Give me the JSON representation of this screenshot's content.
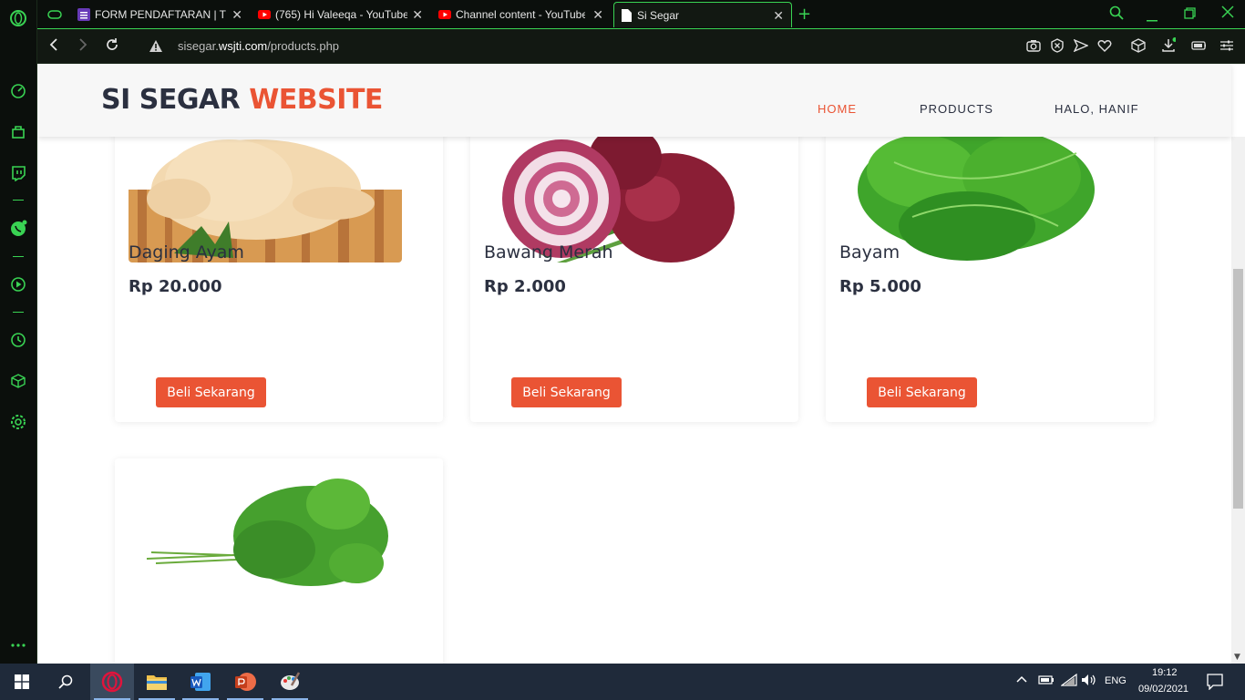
{
  "browser": {
    "tabs": [
      {
        "title": "FORM PENDAFTARAN | TIF",
        "icon": "forms-icon",
        "color": "#673ab7"
      },
      {
        "title": "(765) Hi Valeeqa - YouTube",
        "icon": "youtube-icon",
        "color": "#ff0000"
      },
      {
        "title": "Channel content - YouTube",
        "icon": "youtube-icon",
        "color": "#ff0000"
      },
      {
        "title": "Si Segar",
        "icon": "document-icon",
        "color": "#ffffff"
      }
    ],
    "url_prefix": "sisegar.",
    "url_domain": "wsjti.com",
    "url_path": "/products.php",
    "accent": "#39d353"
  },
  "site": {
    "logo_main": "SI SEGAR",
    "logo_accent": "WEBSITE",
    "nav": {
      "home": "HOME",
      "products": "PRODUCTS",
      "user": "HALO, HANIF"
    },
    "accent_color": "#ea5434"
  },
  "products": [
    {
      "name": "Daging Ayam",
      "price": "Rp 20.000",
      "button": "Beli Sekarang"
    },
    {
      "name": "Bawang Merah",
      "price": "Rp 2.000",
      "button": "Beli Sekarang"
    },
    {
      "name": "Bayam",
      "price": "Rp 5.000",
      "button": "Beli Sekarang"
    }
  ],
  "taskbar": {
    "language": "ENG",
    "time": "19:12",
    "date": "09/02/2021"
  }
}
